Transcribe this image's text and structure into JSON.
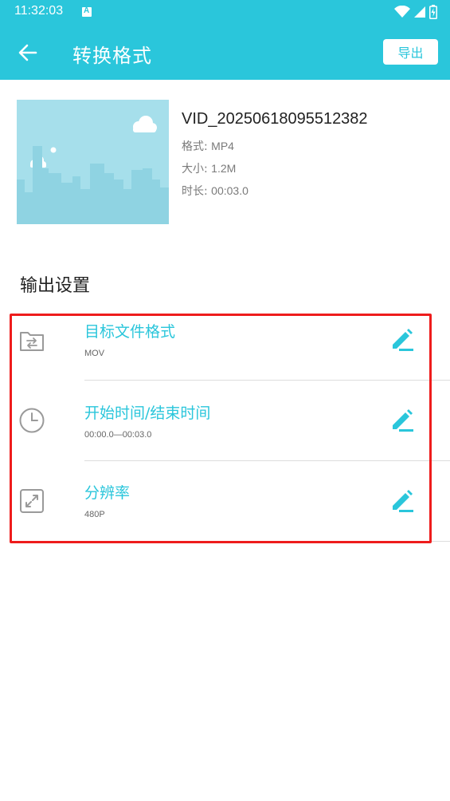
{
  "status_bar": {
    "time": "11:32:03",
    "notification_glyph": "A"
  },
  "app_bar": {
    "title": "转换格式",
    "export_label": "导出"
  },
  "video": {
    "name": "VID_20250618095512382",
    "format_label": "格式:",
    "format_value": "MP4",
    "size_label": "大小:",
    "size_value": "1.2M",
    "duration_label": "时长:",
    "duration_value": "00:03.0"
  },
  "output": {
    "title": "输出设置",
    "items": [
      {
        "label": "目标文件格式",
        "value": "MOV",
        "icon": "folder-transfer-icon"
      },
      {
        "label": "开始时间/结束时间",
        "value": "00:00.0—00:03.0",
        "icon": "clock-icon"
      },
      {
        "label": "分辨率",
        "value": "480P",
        "icon": "resize-icon"
      }
    ]
  },
  "colors": {
    "primary": "#2ac6db",
    "highlight": "#ee1c1c"
  }
}
